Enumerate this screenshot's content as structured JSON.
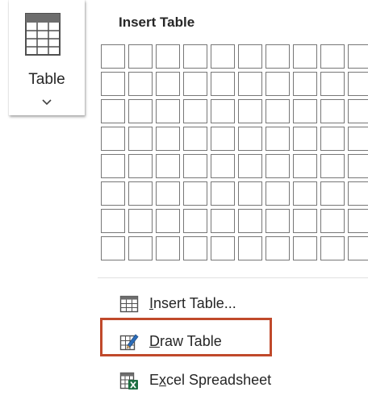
{
  "ribbon": {
    "table_button": {
      "label": "Table",
      "icon": "table-grid-icon",
      "chevron_icon": "chevron-down-icon"
    }
  },
  "dropdown": {
    "header": "Insert Table",
    "grid": {
      "columns": 10,
      "rows": 8
    },
    "menu_items": [
      {
        "id": "insert-table",
        "label_before": "",
        "mnemonic": "I",
        "label_after": "nsert Table...",
        "icon": "insert-table-icon"
      },
      {
        "id": "draw-table",
        "label_before": "",
        "mnemonic": "D",
        "label_after": "raw Table",
        "icon": "draw-table-pencil-icon",
        "highlighted": true
      },
      {
        "id": "excel-spreadsheet",
        "label_before": "E",
        "mnemonic": "x",
        "label_after": "cel Spreadsheet",
        "icon": "excel-spreadsheet-icon"
      }
    ]
  },
  "colors": {
    "highlight_border": "#c0492b",
    "excel_green": "#1d6f42",
    "pencil_blue": "#2b6cb8",
    "grid_line": "#777777"
  }
}
